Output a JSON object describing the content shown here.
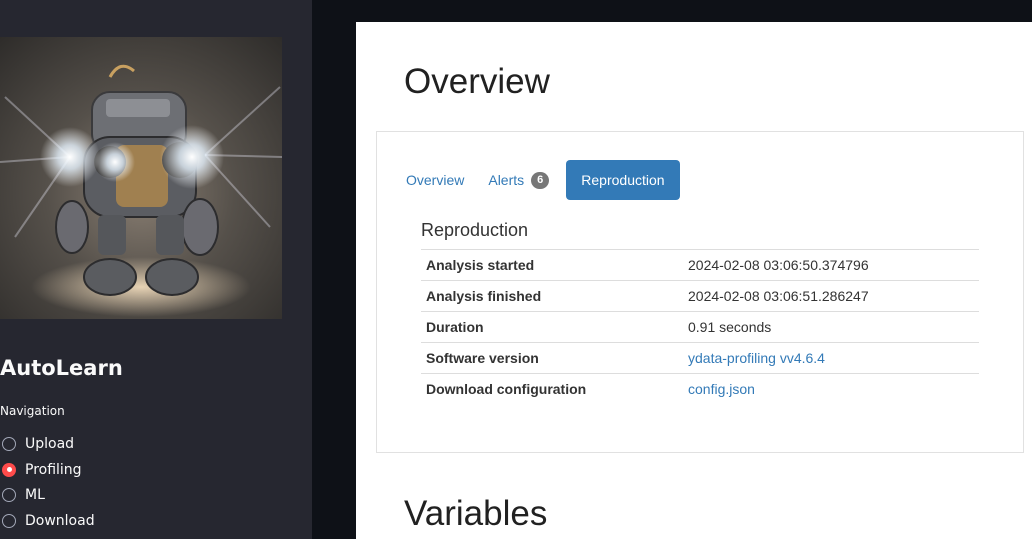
{
  "sidebar": {
    "logo_icon": "robot-image",
    "app_title": "AutoLearn",
    "nav_label": "Navigation",
    "nav_items": [
      {
        "label": "Upload",
        "selected": false
      },
      {
        "label": "Profiling",
        "selected": true
      },
      {
        "label": "ML",
        "selected": false
      },
      {
        "label": "Download",
        "selected": false
      }
    ],
    "accent_color": "#ff4b4b"
  },
  "main": {
    "overview_heading": "Overview",
    "tabs": [
      {
        "label": "Overview"
      },
      {
        "label": "Alerts",
        "badge": "6"
      },
      {
        "label": "Reproduction",
        "active": true
      }
    ],
    "reproduction": {
      "title": "Reproduction",
      "rows": [
        {
          "key": "Analysis started",
          "value": "2024-02-08 03:06:50.374796"
        },
        {
          "key": "Analysis finished",
          "value": "2024-02-08 03:06:51.286247"
        },
        {
          "key": "Duration",
          "value": "0.91 seconds"
        },
        {
          "key": "Software version",
          "value": "ydata-profiling vv4.6.4"
        },
        {
          "key": "Download configuration",
          "value": "config.json"
        }
      ]
    },
    "variables_heading": "Variables"
  }
}
